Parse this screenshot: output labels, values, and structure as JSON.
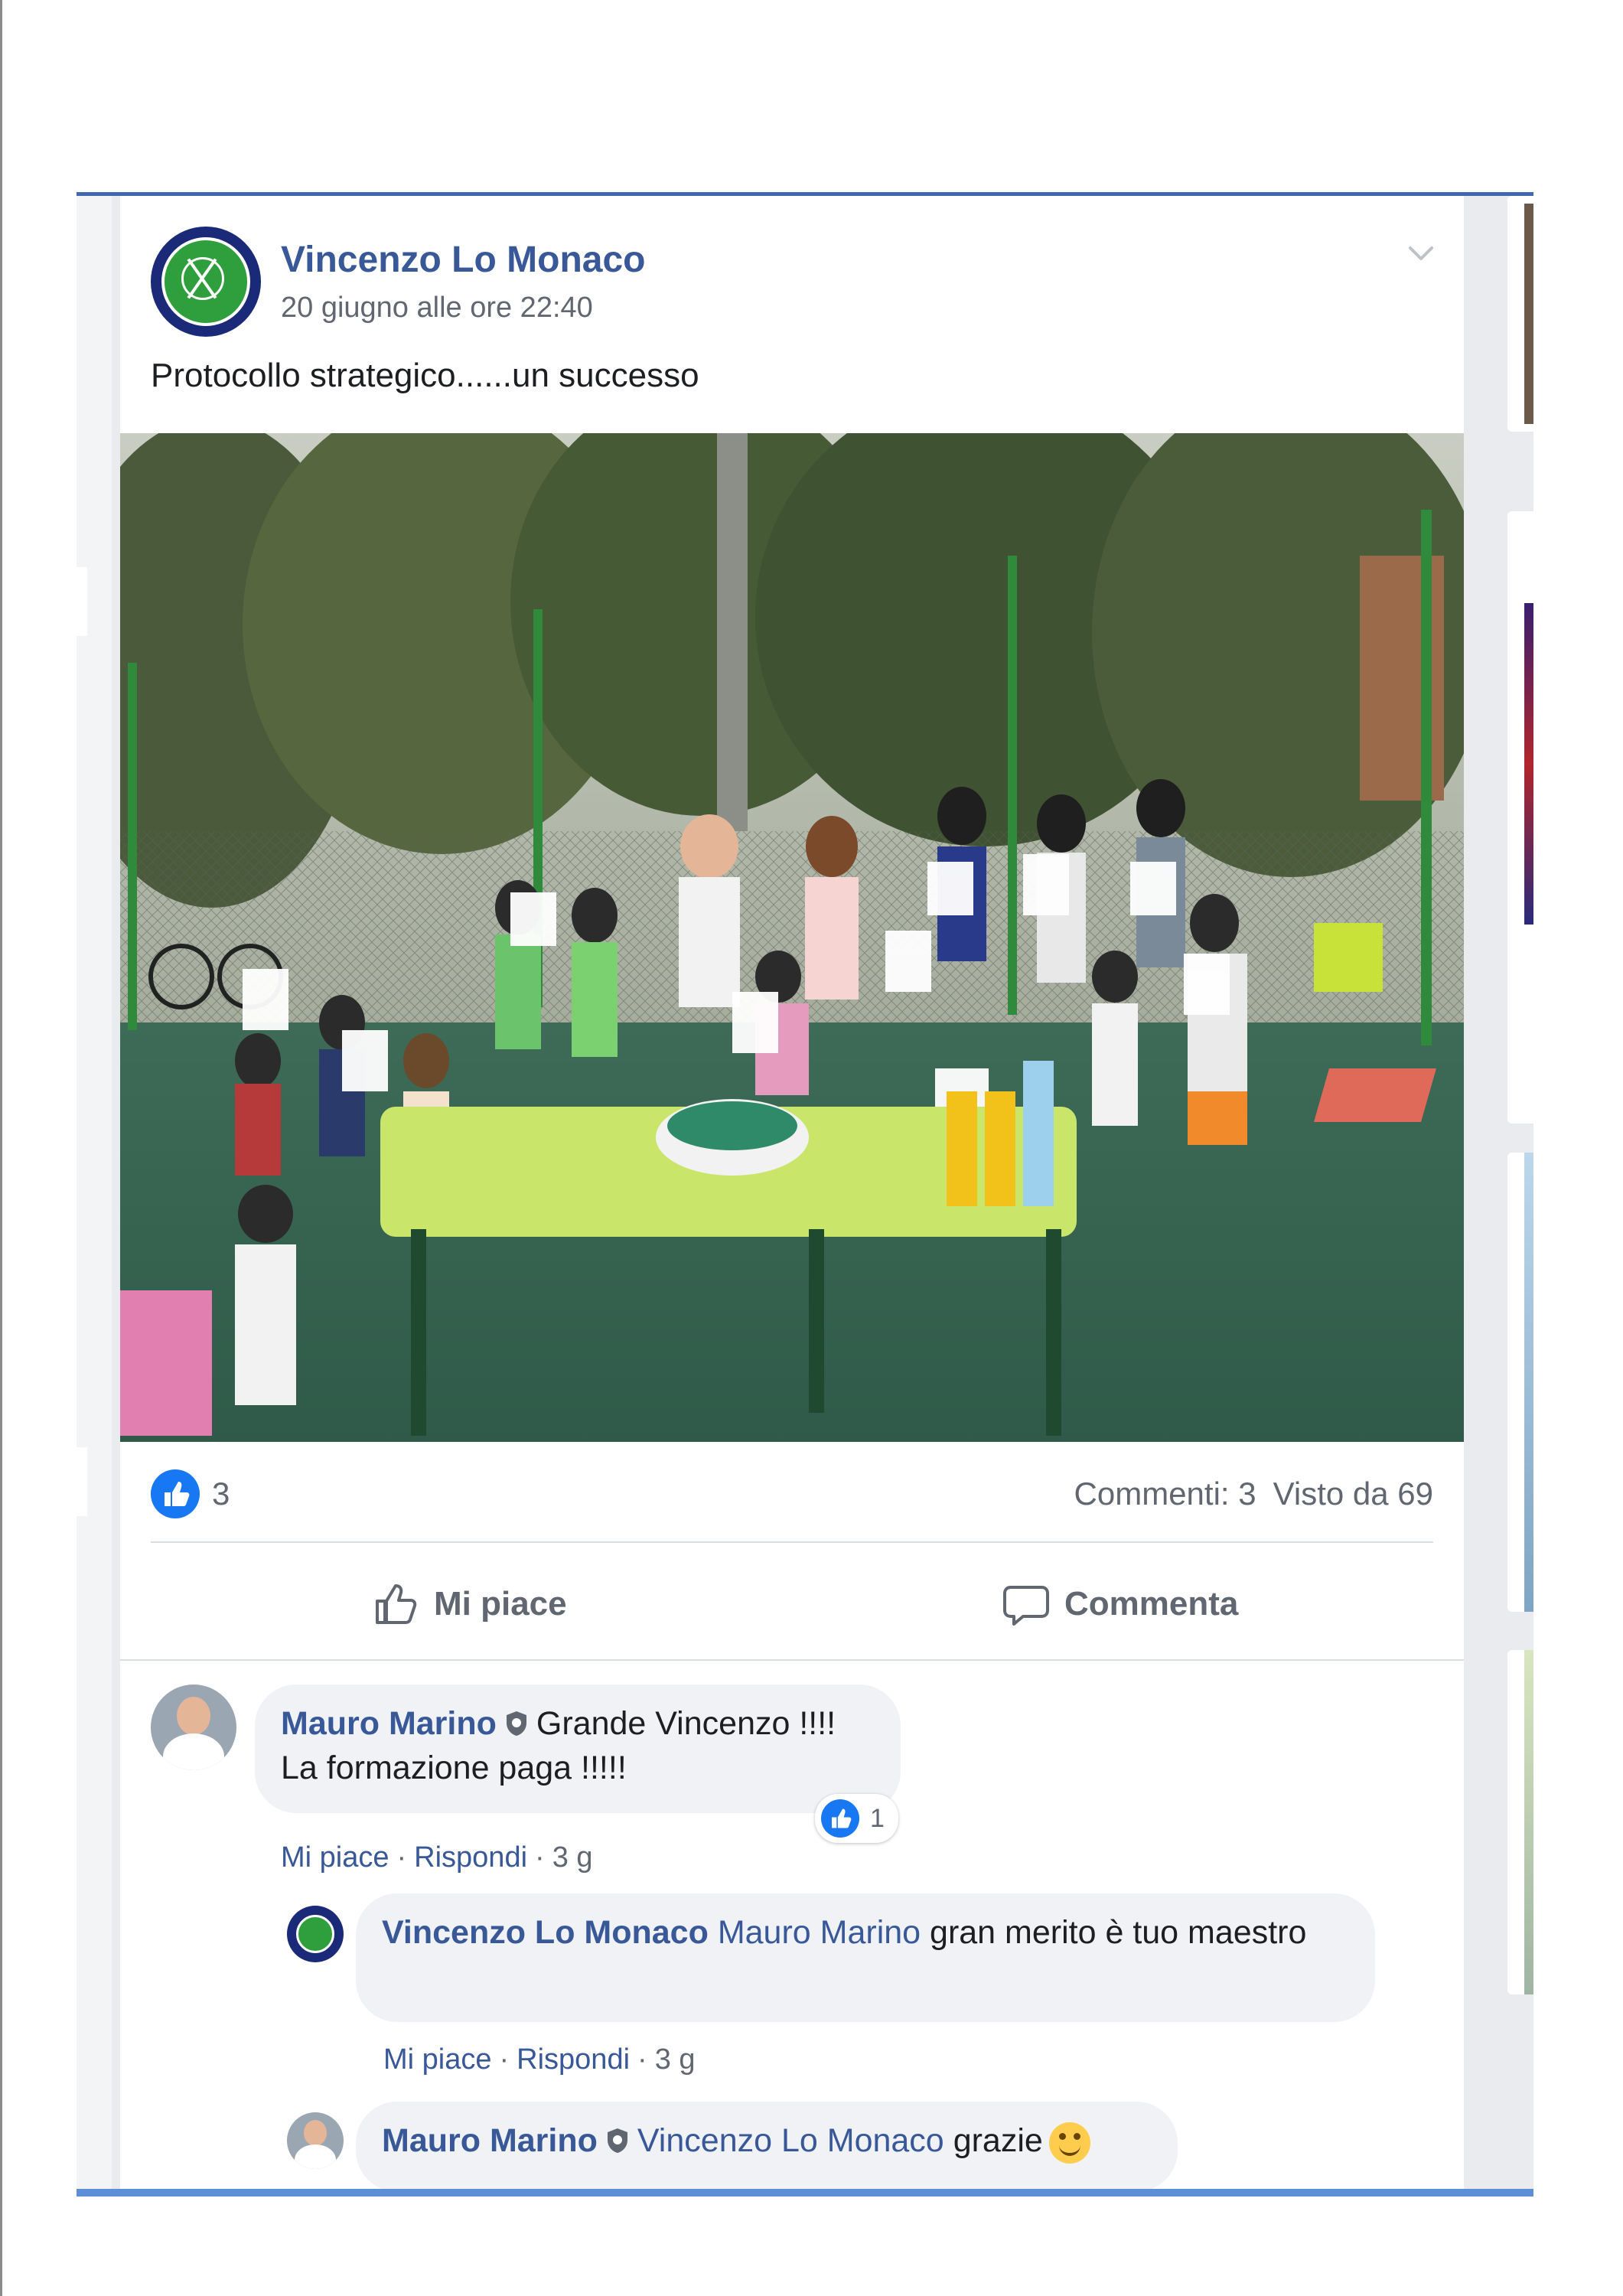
{
  "post": {
    "author": "Vincenzo Lo Monaco",
    "timestamp": "20 giugno alle ore 22:40",
    "text": "Protocollo strategico......un successo",
    "avatar_icon": "tennis-club-logo",
    "menu_icon": "chevron-down-icon"
  },
  "stats": {
    "reactions_count": "3",
    "comments": "Commenti: 3",
    "views": "Visto da 69"
  },
  "actions": {
    "like_label": "Mi piace",
    "comment_label": "Commenta"
  },
  "comments": [
    {
      "author": "Mauro Marino",
      "text_line1": "Grande Vincenzo !!!!",
      "text_line2": "La formazione paga !!!!!",
      "reaction_count": "1",
      "like_link": "Mi piace",
      "reply_link": "Rispondi",
      "age": "3 g"
    },
    {
      "author": "Vincenzo Lo Monaco",
      "mention": "Mauro Marino",
      "text": "gran merito è tuo maestro",
      "like_link": "Mi piace",
      "reply_link": "Rispondi",
      "age": "3 g"
    },
    {
      "author": "Mauro Marino",
      "mention": "Vincenzo Lo Monaco",
      "text": "grazie"
    }
  ],
  "colors": {
    "facebook_blue": "#4267b2",
    "link_blue": "#385898",
    "like_blue": "#1877f2",
    "muted_text": "#606770",
    "background": "#e9ebee"
  }
}
